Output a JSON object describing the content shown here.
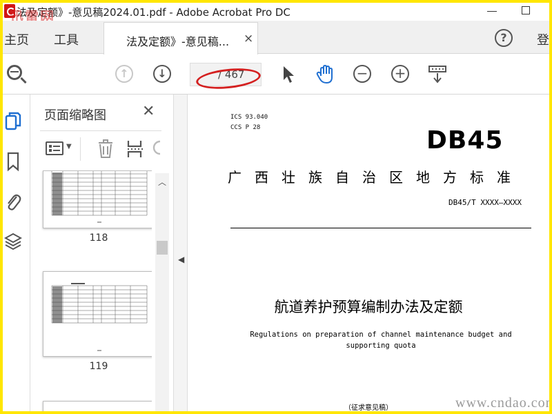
{
  "window": {
    "title": "法及定额》-意见稿2024.01.pdf - Adobe Acrobat Pro DC",
    "watermark_top": "迅雷网",
    "frame_color": "#ffe600",
    "app_icon": "acrobat-icon"
  },
  "tabs": {
    "home": "主页",
    "tools": "工具",
    "document": "法及定额》-意见稿...",
    "close_glyph": "×",
    "help_glyph": "?",
    "signin": "登录"
  },
  "toolbar": {
    "page_total": "/ 467",
    "icons": [
      "search-icon",
      "prev-page-icon",
      "next-page-icon",
      "select-cursor-icon",
      "hand-icon",
      "zoom-out-icon",
      "zoom-in-icon",
      "scroll-mode-icon"
    ]
  },
  "sidebar": {
    "icons": [
      "page-thumbnails-icon",
      "bookmark-icon",
      "attachment-icon",
      "layers-icon"
    ]
  },
  "thumbnails": {
    "title": "页面缩略图",
    "close_glyph": "✕",
    "pages": [
      {
        "number": "118"
      },
      {
        "number": "119"
      }
    ]
  },
  "document": {
    "meta_line1": "ICS  93.040",
    "meta_line2": "CCS  P 28",
    "code": "DB45",
    "region_standard": "广西壮族自治区地方标准",
    "standard_number": "DB45/T XXXX—XXXX",
    "title_cn": "航道养护预算编制办法及定额",
    "title_en_line1": "Regulations on preparation of channel maintenance budget and",
    "title_en_line2": "supporting quota",
    "draft_note": "（征求意见稿）",
    "watermark_bottom": "www.cndao.com"
  },
  "annotation_color": "#d42020"
}
